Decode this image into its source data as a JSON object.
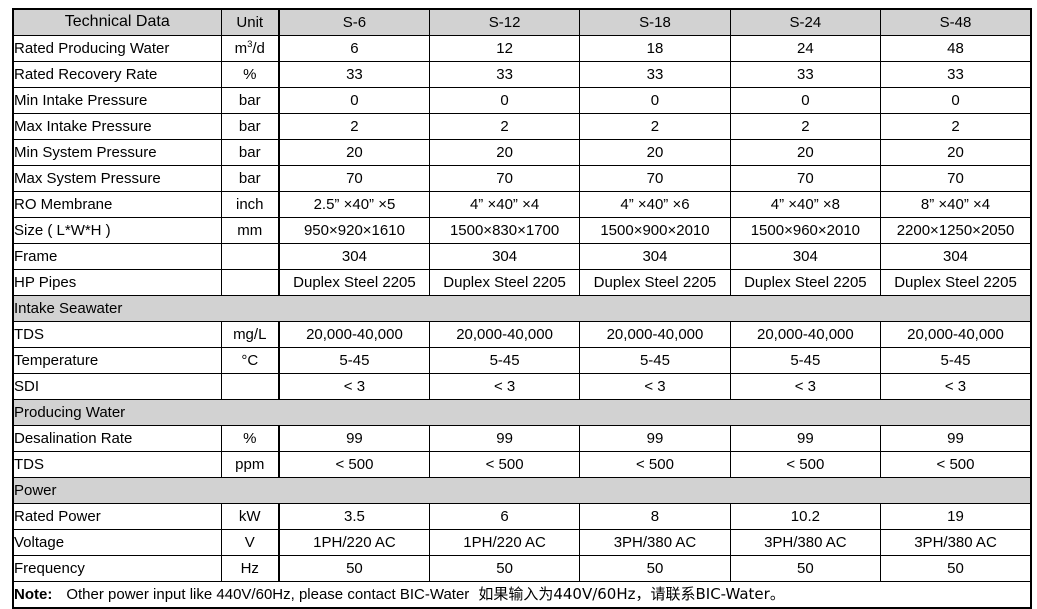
{
  "table": {
    "headers": {
      "name": "Technical Data",
      "unit": "Unit",
      "models": [
        "S-6",
        "S-12",
        "S-18",
        "S-24",
        "S-48"
      ]
    },
    "rows": [
      {
        "kind": "data",
        "name": "Rated Producing Water",
        "unit_html": "m<sup>3</sup>/d",
        "unit": "m3/d",
        "values": [
          "6",
          "12",
          "18",
          "24",
          "48"
        ]
      },
      {
        "kind": "data",
        "name": "Rated Recovery Rate",
        "unit": "%",
        "values": [
          "33",
          "33",
          "33",
          "33",
          "33"
        ]
      },
      {
        "kind": "data",
        "name": "Min Intake Pressure",
        "unit": "bar",
        "values": [
          "0",
          "0",
          "0",
          "0",
          "0"
        ]
      },
      {
        "kind": "data",
        "name": "Max Intake Pressure",
        "unit": "bar",
        "values": [
          "2",
          "2",
          "2",
          "2",
          "2"
        ]
      },
      {
        "kind": "data",
        "name": "Min System Pressure",
        "unit": "bar",
        "values": [
          "20",
          "20",
          "20",
          "20",
          "20"
        ]
      },
      {
        "kind": "data",
        "name": "Max System Pressure",
        "unit": "bar",
        "values": [
          "70",
          "70",
          "70",
          "70",
          "70"
        ]
      },
      {
        "kind": "data",
        "name": "RO Membrane",
        "unit": "inch",
        "values": [
          "2.5”  ×40”  ×5",
          "4”  ×40”  ×4",
          "4”  ×40”  ×6",
          "4”  ×40”  ×8",
          "8”  ×40”  ×4"
        ]
      },
      {
        "kind": "data",
        "name": "Size ( L*W*H )",
        "unit": "mm",
        "values": [
          "950×920×1610",
          "1500×830×1700",
          "1500×900×2010",
          "1500×960×2010",
          "2200×1250×2050"
        ]
      },
      {
        "kind": "data",
        "name": "Frame",
        "unit": "",
        "values": [
          "304",
          "304",
          "304",
          "304",
          "304"
        ]
      },
      {
        "kind": "data",
        "name": "HP Pipes",
        "unit": "",
        "values": [
          "Duplex Steel 2205",
          "Duplex Steel 2205",
          "Duplex Steel 2205",
          "Duplex Steel 2205",
          "Duplex Steel 2205"
        ]
      },
      {
        "kind": "section",
        "name": "Intake Seawater"
      },
      {
        "kind": "data",
        "name": "TDS",
        "unit": "mg/L",
        "values": [
          "20,000-40,000",
          "20,000-40,000",
          "20,000-40,000",
          "20,000-40,000",
          "20,000-40,000"
        ]
      },
      {
        "kind": "data",
        "name": "Temperature",
        "unit": "°C",
        "values": [
          "5-45",
          "5-45",
          "5-45",
          "5-45",
          "5-45"
        ]
      },
      {
        "kind": "data",
        "name": "SDI",
        "unit": "",
        "values": [
          "< 3",
          "< 3",
          "< 3",
          "< 3",
          "< 3"
        ]
      },
      {
        "kind": "section",
        "name": "Producing Water"
      },
      {
        "kind": "data",
        "name": "Desalination Rate",
        "unit": "%",
        "values": [
          "99",
          "99",
          "99",
          "99",
          "99"
        ]
      },
      {
        "kind": "data",
        "name": "TDS",
        "unit": "ppm",
        "values": [
          "< 500",
          "< 500",
          "< 500",
          "< 500",
          "< 500"
        ]
      },
      {
        "kind": "section",
        "name": "Power"
      },
      {
        "kind": "data",
        "name": "Rated Power",
        "unit": "kW",
        "values": [
          "3.5",
          "6",
          "8",
          "10.2",
          "19"
        ]
      },
      {
        "kind": "data",
        "name": "Voltage",
        "unit": "V",
        "values": [
          "1PH/220 AC",
          "1PH/220 AC",
          "3PH/380 AC",
          "3PH/380 AC",
          "3PH/380 AC"
        ]
      },
      {
        "kind": "data",
        "name": "Frequency",
        "unit": "Hz",
        "values": [
          "50",
          "50",
          "50",
          "50",
          "50"
        ]
      }
    ],
    "note": {
      "label": "Note:",
      "text_en": "Other power input like 440V/60Hz, please contact BIC-Water",
      "text_zh": "如果输入为440V/60Hz，请联系BIC-Water。"
    }
  },
  "colors": {
    "header_gray": "#d2d2d2",
    "border": "#000000",
    "background": "#ffffff",
    "text": "#000000"
  }
}
